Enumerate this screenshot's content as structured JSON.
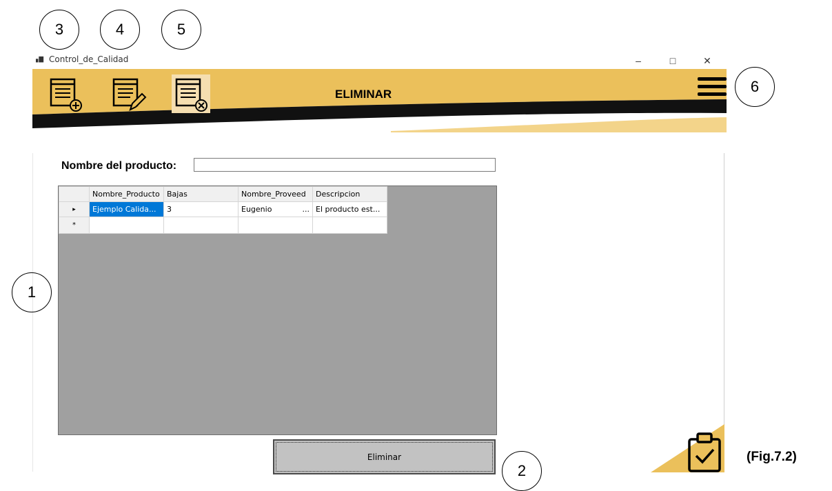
{
  "window": {
    "title": "Control_de_Calidad",
    "minimize_glyph": "–",
    "maximize_glyph": "□",
    "close_glyph": "✕"
  },
  "header": {
    "title": "ELIMINAR",
    "tools": [
      {
        "name": "add-record-icon"
      },
      {
        "name": "edit-record-icon"
      },
      {
        "name": "delete-record-icon",
        "active": true
      }
    ]
  },
  "form": {
    "nombre_label": "Nombre del producto:",
    "nombre_value": ""
  },
  "grid": {
    "columns": [
      "Nombre_Producto",
      "Bajas",
      "Nombre_Proveed",
      "Descripcion"
    ],
    "rows": [
      [
        "Ejemplo Calida...",
        "3",
        "Eugenio",
        "El producto est..."
      ]
    ],
    "current_row_marker": "▸",
    "new_row_marker": "*",
    "ellipsis": "..."
  },
  "actions": {
    "eliminar_label": "Eliminar"
  },
  "callouts": [
    "1",
    "2",
    "3",
    "4",
    "5",
    "6"
  ],
  "figure_caption": "(Fig.7.2)",
  "colors": {
    "accent": "#ebc05b",
    "stripe": "#111111",
    "grid_bg": "#a0a0a0",
    "selected": "#0078d7"
  }
}
